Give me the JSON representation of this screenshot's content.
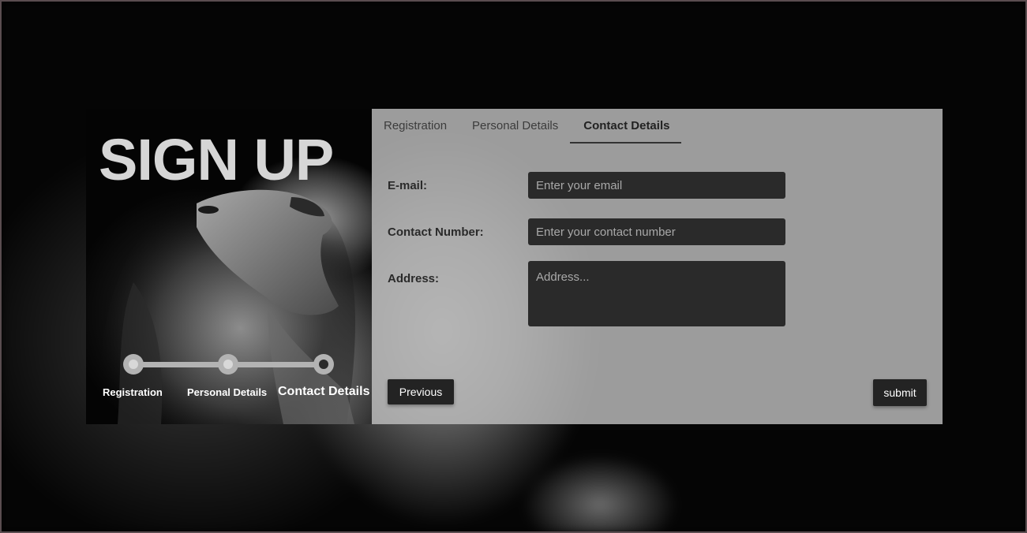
{
  "left_panel": {
    "title": "SIGN UP",
    "steps": [
      {
        "label": "Registration",
        "active": false
      },
      {
        "label": "Personal Details",
        "active": false
      },
      {
        "label": "Contact Details",
        "active": true
      }
    ]
  },
  "tabs": [
    {
      "label": "Registration",
      "active": false
    },
    {
      "label": "Personal Details",
      "active": false
    },
    {
      "label": "Contact Details",
      "active": true
    }
  ],
  "form": {
    "email": {
      "label": "E-mail:",
      "placeholder": "Enter your email",
      "value": ""
    },
    "contact": {
      "label": "Contact Number:",
      "placeholder": "Enter your contact number",
      "value": ""
    },
    "address": {
      "label": "Address:",
      "placeholder": "Address...",
      "value": ""
    }
  },
  "buttons": {
    "previous": "Previous",
    "submit": "submit"
  },
  "colors": {
    "panel_bg": "#bebebe",
    "field_bg": "#2a2a2a",
    "button_bg": "#232323",
    "progress": "#b3b3b3"
  }
}
